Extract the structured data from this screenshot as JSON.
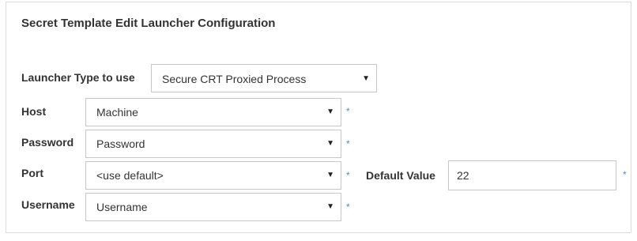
{
  "panel": {
    "title": "Secret Template Edit Launcher Configuration"
  },
  "launcher_type": {
    "label": "Launcher Type to use",
    "selected": "Secure CRT Proxied Process"
  },
  "fields": {
    "host": {
      "label": "Host",
      "selected": "Machine",
      "required_mark": "*"
    },
    "password": {
      "label": "Password",
      "selected": "Password",
      "required_mark": "*"
    },
    "port": {
      "label": "Port",
      "selected": "<use default>",
      "required_mark": "*",
      "default_value_label": "Default Value",
      "default_value": "22",
      "default_required_mark": "*"
    },
    "username": {
      "label": "Username",
      "selected": "Username",
      "required_mark": "*"
    }
  },
  "icons": {
    "dropdown": "chevron-down-icon",
    "caret_glyph": "▼"
  },
  "colors": {
    "required_mark": "#4a8fd6",
    "label_text": "#333333",
    "border": "#c6c6c6"
  }
}
